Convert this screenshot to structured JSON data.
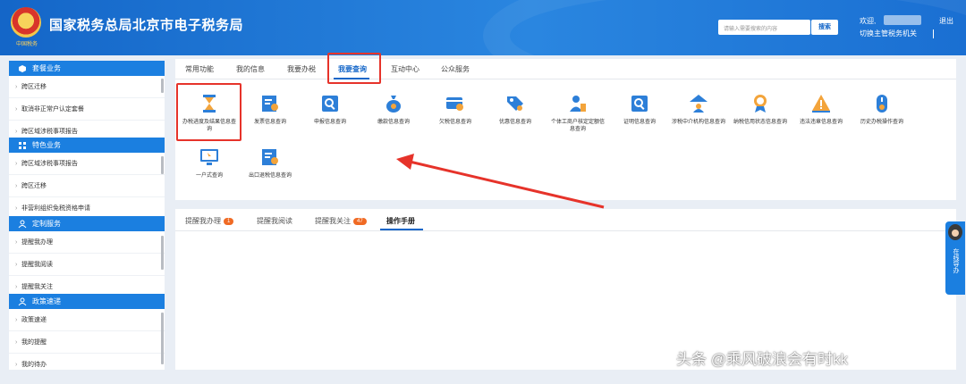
{
  "header": {
    "emblem_caption": "中国税务",
    "title": "国家税务总局北京市电子税务局",
    "search_placeholder": "请输入需要搜索的内容",
    "search_button": "搜索",
    "welcome": "欢迎,",
    "switch_org": "切换主管税务机关",
    "logout": "退出"
  },
  "sidebar": {
    "sections": [
      {
        "title": "套餐业务",
        "icon": "package-icon",
        "items": [
          "跨区迁移",
          "取消非正常户认定套餐",
          "跨区域涉税事项报告"
        ]
      },
      {
        "title": "特色业务",
        "icon": "grid-icon",
        "items": [
          "跨区域涉税事项报告",
          "跨区迁移",
          "非营利组织免税资格申请"
        ]
      },
      {
        "title": "定制服务",
        "icon": "user-icon",
        "items": [
          "提醒我办理",
          "提醒我阅读",
          "提醒我关注"
        ]
      },
      {
        "title": "政策速递",
        "icon": "user-icon",
        "items": [
          "政策速递",
          "我的提醒",
          "我的待办"
        ]
      }
    ]
  },
  "tabs": {
    "items": [
      "常用功能",
      "我的信息",
      "我要办税",
      "我要查询",
      "互动中心",
      "公众服务"
    ],
    "active_index": 3
  },
  "functions": [
    {
      "label": "办税进度及结果信息查询",
      "icon": "hourglass-icon"
    },
    {
      "label": "发票信息查询",
      "icon": "invoice-search-icon"
    },
    {
      "label": "申报信息查询",
      "icon": "declaration-search-icon"
    },
    {
      "label": "缴款信息查询",
      "icon": "money-bag-icon"
    },
    {
      "label": "欠税信息查询",
      "icon": "card-search-icon"
    },
    {
      "label": "优惠信息查询",
      "icon": "discount-tag-icon"
    },
    {
      "label": "个体工商户核定定额信息查询",
      "icon": "person-doc-icon"
    },
    {
      "label": "证明信息查询",
      "icon": "certificate-search-icon"
    },
    {
      "label": "涉税中介机构信息查询",
      "icon": "agency-icon"
    },
    {
      "label": "纳税信用状态信息查询",
      "icon": "credit-medal-icon"
    },
    {
      "label": "违法违章信息查询",
      "icon": "warning-icon"
    },
    {
      "label": "历史办税操作查询",
      "icon": "history-mouse-icon"
    },
    {
      "label": "一户式查询",
      "icon": "monitor-icon"
    },
    {
      "label": "出口退税信息查询",
      "icon": "export-search-icon"
    }
  ],
  "bottom_tabs": {
    "items": [
      {
        "label": "提醒我办理",
        "badge": "1"
      },
      {
        "label": "提醒我阅读",
        "badge": ""
      },
      {
        "label": "提醒我关注",
        "badge": "47"
      },
      {
        "label": "操作手册",
        "badge": ""
      }
    ],
    "active_index": 3
  },
  "nav_guide": {
    "label": "在线导办"
  },
  "watermark": "头条 @乘风破浪会有时kk",
  "colors": {
    "brand": "#1466c8",
    "sidebar_head": "#1b7fe0",
    "annotation": "#e6332a",
    "badge": "#f06a24"
  }
}
